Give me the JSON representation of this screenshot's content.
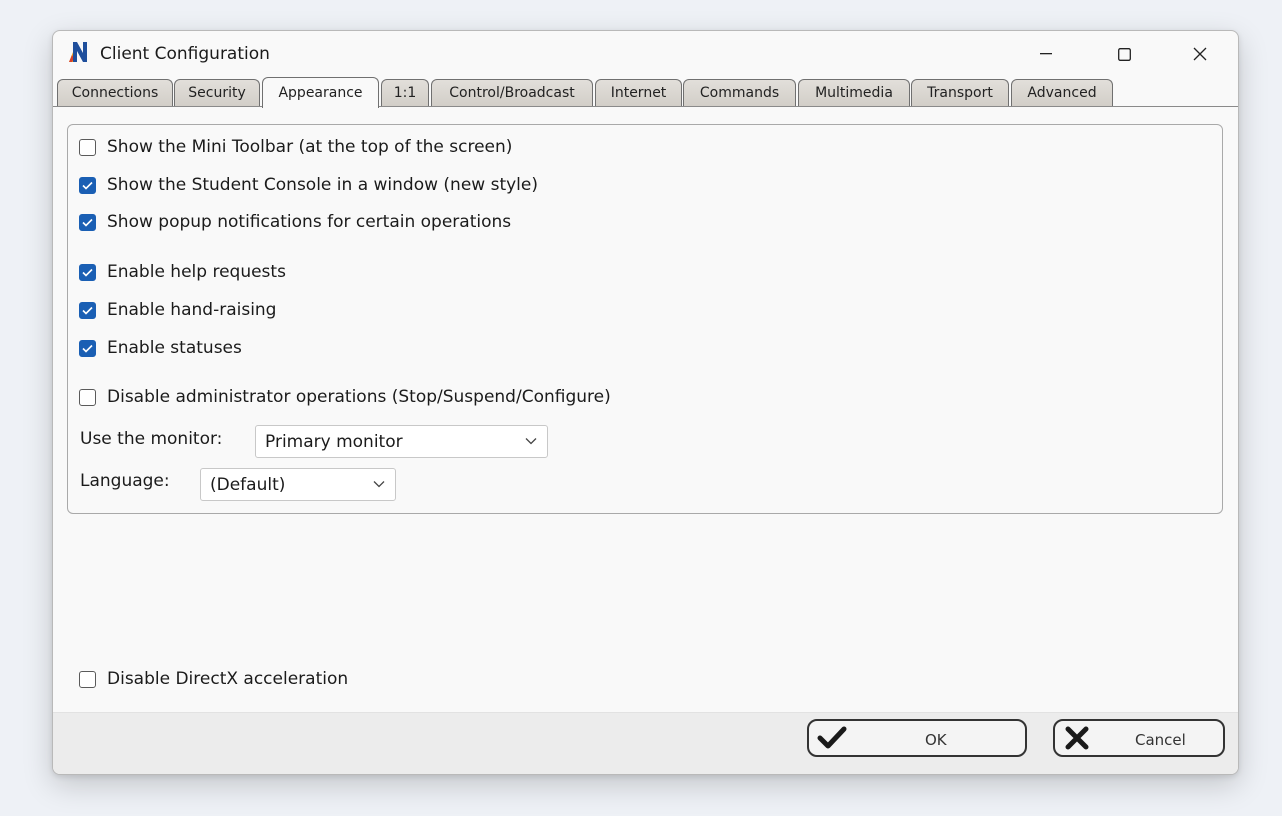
{
  "window": {
    "title": "Client Configuration"
  },
  "tabs": [
    {
      "label": "Connections",
      "active": false
    },
    {
      "label": "Security",
      "active": false
    },
    {
      "label": "Appearance",
      "active": true
    },
    {
      "label": "1:1",
      "active": false
    },
    {
      "label": "Control/Broadcast",
      "active": false
    },
    {
      "label": "Internet",
      "active": false
    },
    {
      "label": "Commands",
      "active": false
    },
    {
      "label": "Multimedia",
      "active": false
    },
    {
      "label": "Transport",
      "active": false
    },
    {
      "label": "Advanced",
      "active": false
    }
  ],
  "options": [
    {
      "label": "Show the Mini Toolbar (at the top of the screen)",
      "checked": false
    },
    {
      "label": "Show the Student Console in a window (new style)",
      "checked": true
    },
    {
      "label": "Show popup notifications for certain operations",
      "checked": true
    },
    {
      "label": "Enable help requests",
      "checked": true
    },
    {
      "label": "Enable hand-raising",
      "checked": true
    },
    {
      "label": "Enable statuses",
      "checked": true
    },
    {
      "label": "Disable administrator operations (Stop/Suspend/Configure)",
      "checked": false
    }
  ],
  "monitor": {
    "label": "Use the monitor:",
    "value": "Primary monitor"
  },
  "language": {
    "label": "Language:",
    "value": "(Default)"
  },
  "directx": {
    "label": "Disable DirectX acceleration",
    "checked": false
  },
  "buttons": {
    "ok": "OK",
    "cancel": "Cancel"
  },
  "colors": {
    "accent": "#1a5fb4",
    "window_bg": "#f9f9f9",
    "footer_bg": "#ececec"
  },
  "icons": {
    "app": "n-logo-icon",
    "minimize": "minimize-icon",
    "maximize": "maximize-icon",
    "close": "close-icon",
    "check": "checkmark-icon",
    "x": "x-icon",
    "dropdown": "chevron-down-icon"
  }
}
